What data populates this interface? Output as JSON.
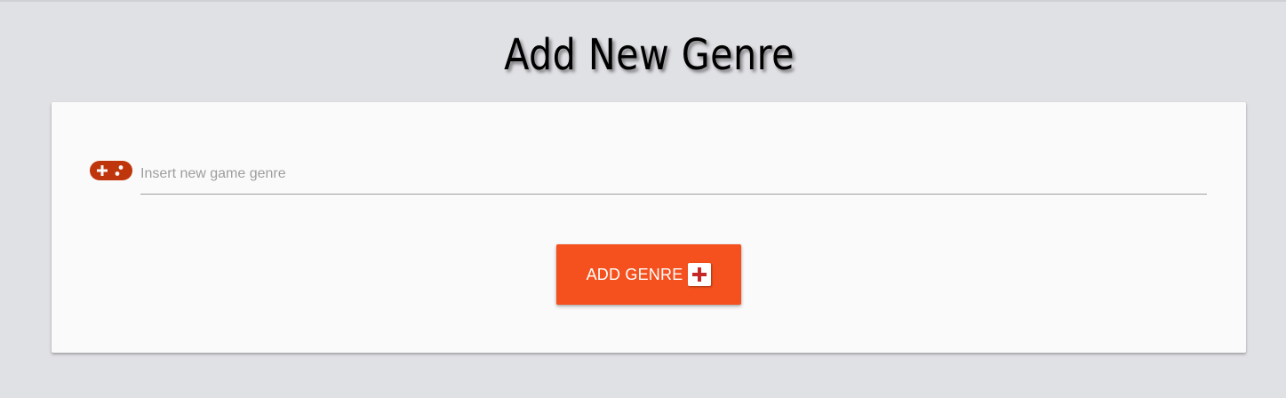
{
  "page": {
    "title": "Add New Genre"
  },
  "form": {
    "genre_input": {
      "placeholder": "Insert new game genre",
      "value": "",
      "icon": "gamepad-icon"
    },
    "submit_button": {
      "label": "ADD GENRE",
      "icon": "plus-box-icon"
    }
  },
  "colors": {
    "background": "#e0e1e5",
    "card": "#fafafa",
    "accent": "#f4511e",
    "icon": "#bf360c"
  }
}
